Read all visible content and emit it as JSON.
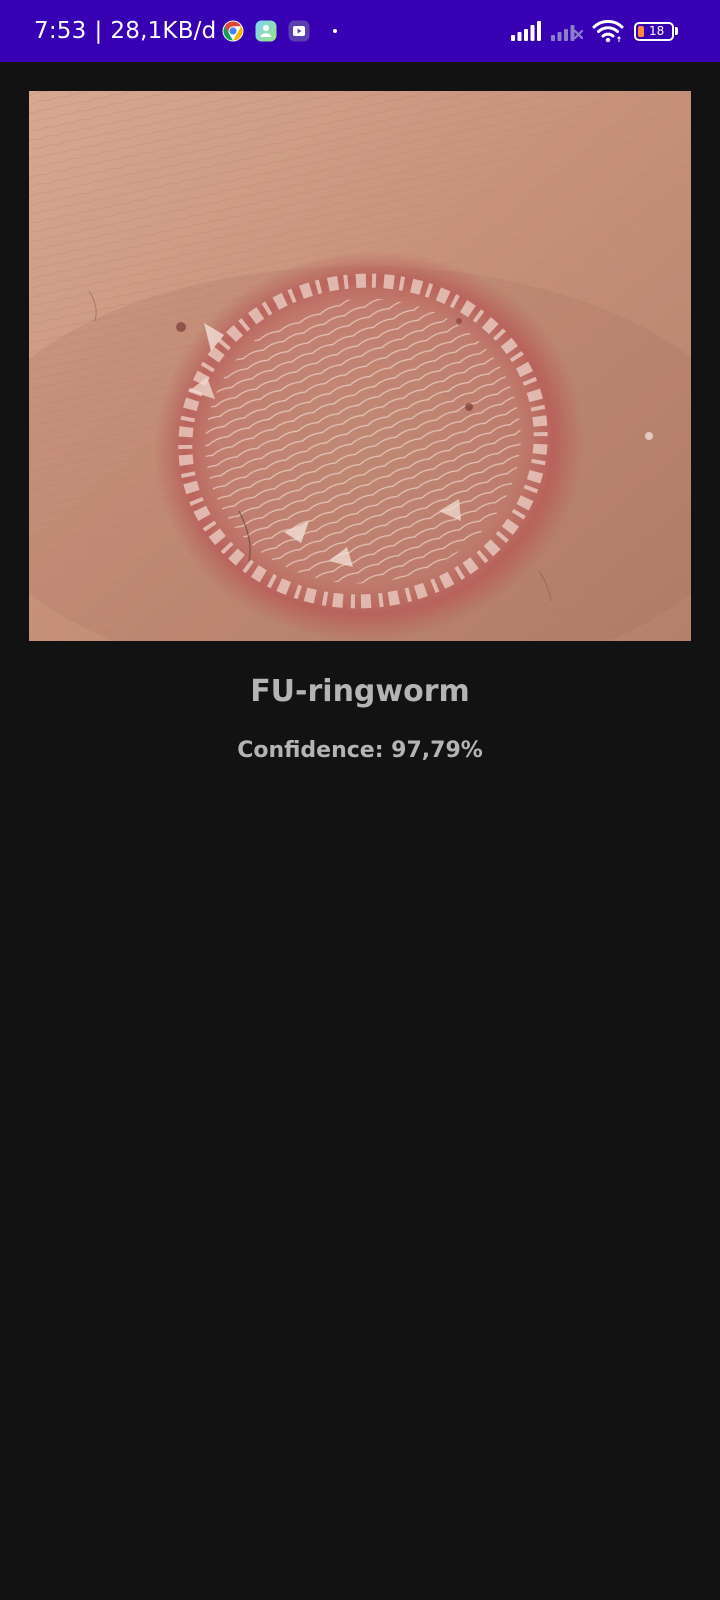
{
  "status_bar": {
    "time": "7:53",
    "separator": "|",
    "data_speed": "28,1KB/d",
    "notification_icons": [
      "chrome-icon",
      "app-icon",
      "video-app-icon"
    ],
    "signal_icons": [
      "signal-bars-icon",
      "signal-bars-no-service-icon",
      "wifi-icon"
    ],
    "battery_level": "18",
    "colors": {
      "background": "#3700b3",
      "battery_fill": "#ff8a3d"
    }
  },
  "result": {
    "image_alt_icon": "skin-photo",
    "label": "FU-ringworm",
    "confidence_text": "Confidence: 97,79%"
  },
  "colors": {
    "page_background": "#121212",
    "text": "#b4b4b4"
  }
}
